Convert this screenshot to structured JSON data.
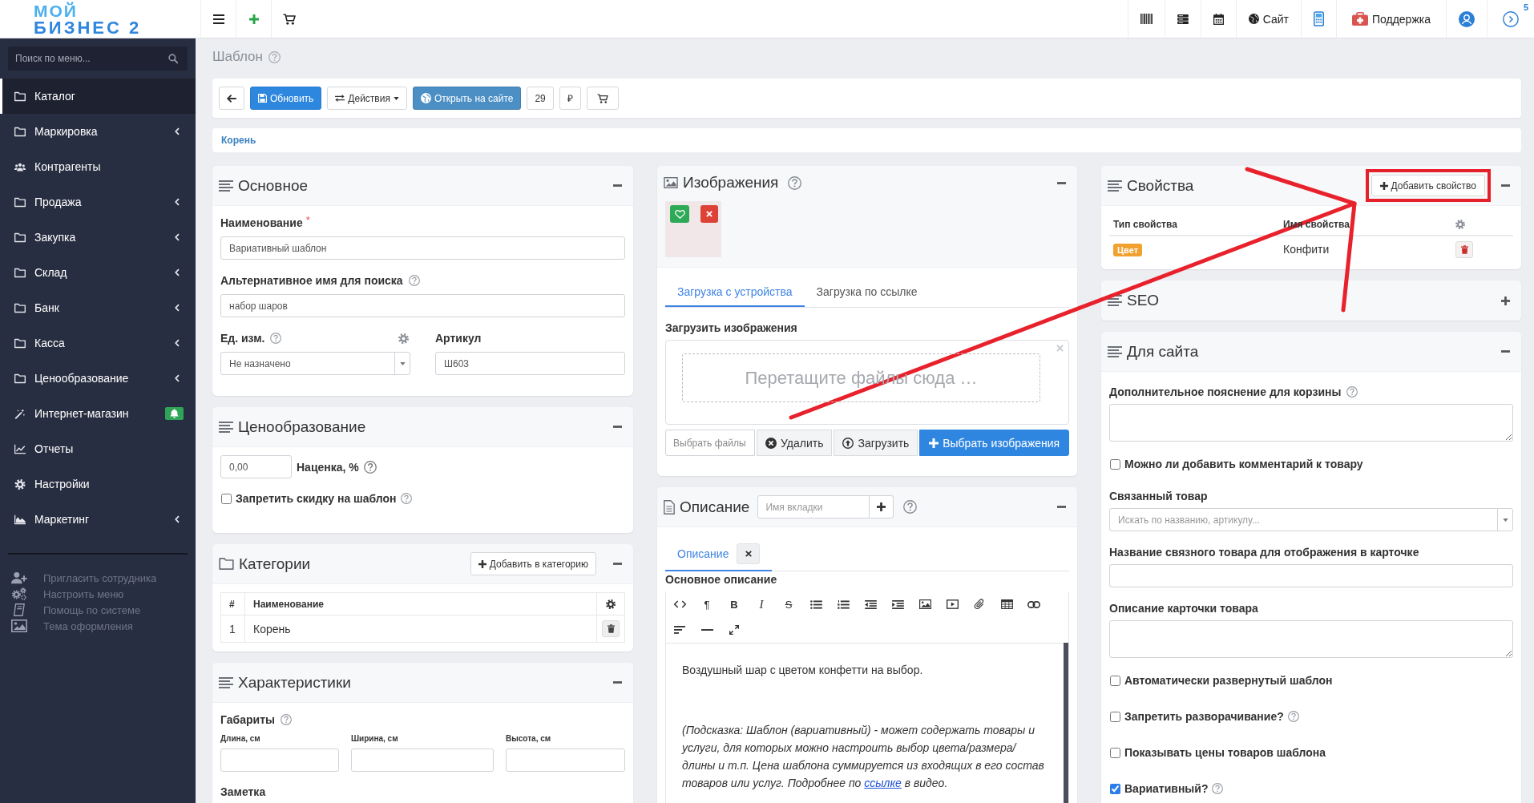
{
  "topbar": {
    "logo": {
      "line1": "МОЙ",
      "line2": "БИЗНЕС 2"
    },
    "site_label": "Сайт",
    "support_label": "Поддержка",
    "notification_count": "5"
  },
  "sidebar": {
    "search_placeholder": "Поиск по меню...",
    "items": [
      {
        "kind": "folder",
        "label": "Каталог",
        "selected": true,
        "has_submenu": false,
        "notification": false
      },
      {
        "kind": "folder",
        "label": "Маркировка",
        "selected": false,
        "has_submenu": true,
        "notification": false
      },
      {
        "kind": "contacts",
        "label": "Контрагенты",
        "selected": false,
        "has_submenu": false,
        "notification": false
      },
      {
        "kind": "folder",
        "label": "Продажа",
        "selected": false,
        "has_submenu": true,
        "notification": false
      },
      {
        "kind": "folder",
        "label": "Закупка",
        "selected": false,
        "has_submenu": true,
        "notification": false
      },
      {
        "kind": "folder",
        "label": "Склад",
        "selected": false,
        "has_submenu": true,
        "notification": false
      },
      {
        "kind": "folder",
        "label": "Банк",
        "selected": false,
        "has_submenu": true,
        "notification": false
      },
      {
        "kind": "folder",
        "label": "Касса",
        "selected": false,
        "has_submenu": true,
        "notification": false
      },
      {
        "kind": "folder",
        "label": "Ценообразование",
        "selected": false,
        "has_submenu": true,
        "notification": false
      },
      {
        "kind": "shop",
        "label": "Интернет-магазин",
        "selected": false,
        "has_submenu": false,
        "notification": true
      },
      {
        "kind": "reports",
        "label": "Отчеты",
        "selected": false,
        "has_submenu": false,
        "notification": false
      },
      {
        "kind": "settings",
        "label": "Настройки",
        "selected": false,
        "has_submenu": false,
        "notification": false
      },
      {
        "kind": "marketing",
        "label": "Маркетинг",
        "selected": false,
        "has_submenu": true,
        "notification": false
      }
    ],
    "links": [
      {
        "kind": "invite",
        "label": "Пригласить сотрудника"
      },
      {
        "kind": "customize",
        "label": "Настроить меню"
      },
      {
        "kind": "help",
        "label": "Помощь по системе"
      },
      {
        "kind": "theme",
        "label": "Тема оформления"
      }
    ]
  },
  "page": {
    "title": "Шаблон",
    "help": true
  },
  "toolbar": [
    {
      "kind": "back"
    },
    {
      "kind": "save",
      "label": "Обновить"
    },
    {
      "kind": "actions",
      "label": "Действия"
    },
    {
      "kind": "site",
      "label": "Открыть на сайте"
    },
    {
      "kind": "plain",
      "label": "29"
    },
    {
      "kind": "plain",
      "label": "₽"
    },
    {
      "kind": "cart"
    }
  ],
  "breadcrumb": [
    "Корень"
  ],
  "columns": [
    [
      {
        "kind": "basic",
        "title": "Основное",
        "expanded": true,
        "name": {
          "label": "Наименование",
          "required_mark": "*",
          "value": "Вариативный шаблон"
        },
        "alt_name": {
          "label": "Альтернативное имя для поиска",
          "help": true,
          "value": "набор шаров"
        },
        "unit": {
          "label": "Ед. изм.",
          "help": true,
          "value": "Не назначено"
        },
        "sku": {
          "label": "Артикул",
          "value": "Ш603"
        }
      },
      {
        "kind": "pricing",
        "title": "Ценообразование",
        "expanded": true,
        "markup": {
          "value": "0,00",
          "label": "Наценка, %",
          "help": true
        },
        "no_discount": {
          "label": "Запретить скидку на шаблон",
          "checked": false,
          "help": true
        }
      },
      {
        "kind": "categories",
        "title": "Категории",
        "expanded": true,
        "add_label": "Добавить в категорию",
        "columns": [
          "#",
          "Наименование"
        ],
        "rows": [
          {
            "number": "1",
            "name": "Корень"
          }
        ]
      },
      {
        "kind": "characteristics",
        "title": "Характеристики",
        "expanded": true,
        "dimensions": {
          "label": "Габариты",
          "help": true,
          "fields": [
            {
              "label": "Длина, см"
            },
            {
              "label": "Ширина, см"
            },
            {
              "label": "Высота, см"
            }
          ]
        },
        "note_label": "Заметка"
      }
    ],
    [
      {
        "kind": "images",
        "title": "Изображения",
        "help": true,
        "expanded": true,
        "thumbnails": [
          {
            "main": true
          }
        ],
        "tabs": [
          {
            "label": "Загрузка с устройства",
            "selected": true
          },
          {
            "label": "Загрузка по ссылке",
            "selected": false
          }
        ],
        "upload_label": "Загрузить изображения",
        "dropzone_text": "Перетащите файлы сюда …",
        "file_placeholder": "Выбрать файлы",
        "buttons": [
          {
            "kind": "remove",
            "label": "Удалить"
          },
          {
            "kind": "upload",
            "label": "Загрузить"
          },
          {
            "kind": "choose",
            "label": "Выбрать изображения"
          }
        ]
      },
      {
        "kind": "description",
        "title": "Описание",
        "help": true,
        "expanded": true,
        "tab_name_placeholder": "Имя вкладки",
        "tabs": [
          {
            "label": "Описание",
            "selected": true
          }
        ],
        "editor_label": "Основное описание",
        "toolbar": [
          {
            "kind": "code"
          },
          {
            "kind": "paragraph",
            "text": "¶"
          },
          {
            "kind": "bold",
            "text": "B"
          },
          {
            "kind": "italic",
            "text": "I"
          },
          {
            "kind": "strike",
            "text": "S"
          },
          {
            "kind": "ul"
          },
          {
            "kind": "ol"
          },
          {
            "kind": "outdent"
          },
          {
            "kind": "indent"
          },
          {
            "kind": "image"
          },
          {
            "kind": "video"
          },
          {
            "kind": "attach"
          },
          {
            "kind": "table"
          },
          {
            "kind": "link"
          },
          {
            "kind": "align"
          },
          {
            "kind": "rule"
          },
          {
            "kind": "fullscreen"
          }
        ],
        "paragraphs": [
          {
            "kind": "plain",
            "text": "Воздушный шар с цветом конфетти на выбор."
          },
          {
            "kind": "hint",
            "text": "(Подсказка: Шаблон (вариативный) - может содержать товары и услуги, для которых можно настроить выбор цвета/размера/ длины и т.п. Цена шаблона суммируется из входящих в его состав товаров или услуг. Подробнее по ",
            "link": "ссылке",
            "text_after": " в видео."
          }
        ]
      }
    ],
    [
      {
        "kind": "properties",
        "title": "Свойства",
        "expanded": true,
        "add_button": {
          "label": "Добавить свойство",
          "highlighted": true
        },
        "columns": [
          "Тип свойства",
          "Имя свойства"
        ],
        "rows": [
          {
            "type": "Цвет",
            "name": "Конфити"
          }
        ]
      },
      {
        "kind": "seo",
        "title": "SEO",
        "expanded": false
      },
      {
        "kind": "site",
        "title": "Для сайта",
        "expanded": true,
        "fields": [
          {
            "kind": "textarea",
            "label": "Дополнительное пояснение для корзины",
            "help": true
          },
          {
            "kind": "checkbox",
            "label": "Можно ли добавить комментарий к товару",
            "checked": false,
            "help": false
          },
          {
            "kind": "select",
            "label": "Связанный товар",
            "placeholder": "Искать по названию, артикулу...",
            "help": false
          },
          {
            "kind": "input",
            "label": "Название связного товара для отображения в карточке",
            "help": false
          },
          {
            "kind": "textarea",
            "label": "Описание карточки товара",
            "help": false
          },
          {
            "kind": "checkbox",
            "label": "Автоматически развернутый шаблон",
            "checked": false,
            "help": false
          },
          {
            "kind": "checkbox",
            "label": "Запретить разворачивание?",
            "checked": false,
            "help": true
          },
          {
            "kind": "checkbox",
            "label": "Показывать цены товаров шаблона",
            "checked": false,
            "help": false
          },
          {
            "kind": "checkbox",
            "label": "Вариативный?",
            "checked": true,
            "help": true
          }
        ]
      }
    ]
  ]
}
